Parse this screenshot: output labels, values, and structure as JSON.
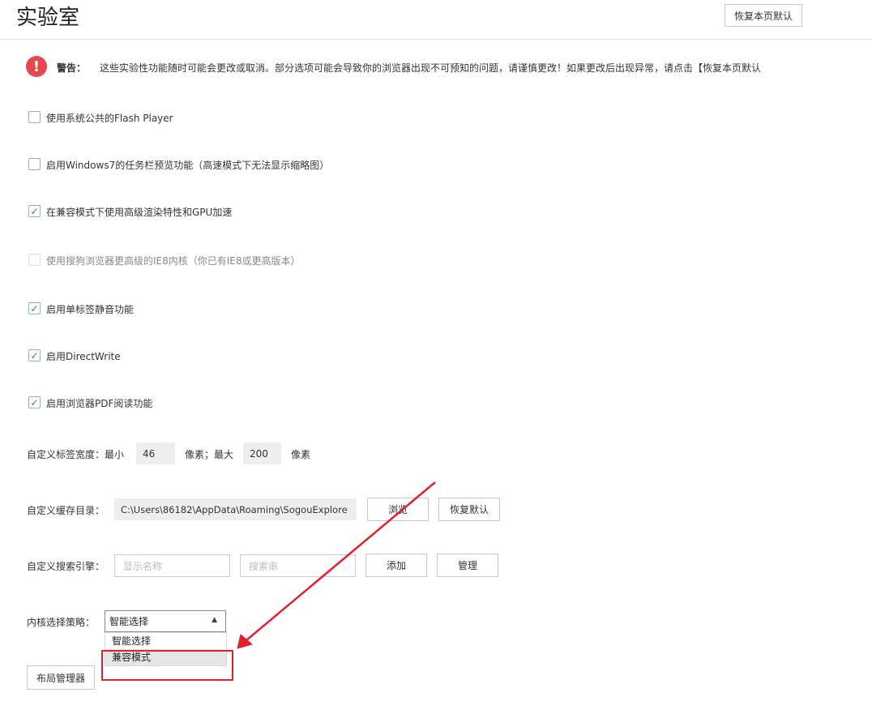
{
  "page": {
    "title": "实验室",
    "restore_page_default": "恢复本页默认"
  },
  "warning": {
    "icon": "!",
    "label": "警告：",
    "text": "这些实验性功能随时可能会更改或取消。部分选项可能会导致你的浏览器出现不可预知的问题，请谨慎更改！如果更改后出现异常，请点击【恢复本页默认"
  },
  "options": [
    {
      "label": "使用系统公共的Flash Player",
      "checked": false,
      "disabled": false
    },
    {
      "label": "启用Windows7的任务栏预览功能（高速模式下无法显示缩略图）",
      "checked": false,
      "disabled": false
    },
    {
      "label": "在兼容模式下使用高级渲染特性和GPU加速",
      "checked": true,
      "disabled": false
    },
    {
      "label": "使用搜狗浏览器更高级的IE8内核（你已有IE8或更高版本）",
      "checked": false,
      "disabled": true
    },
    {
      "label": "启用单标签静音功能",
      "checked": true,
      "disabled": false
    },
    {
      "label": "启用DirectWrite",
      "checked": true,
      "disabled": false
    },
    {
      "label": "启用浏览器PDF阅读功能",
      "checked": true,
      "disabled": false
    }
  ],
  "tab_width": {
    "label": "自定义标签宽度：最小",
    "min_value": "46",
    "unit_mid": "像素；最大",
    "max_value": "200",
    "unit_end": "像素"
  },
  "cache_dir": {
    "label": "自定义缓存目录：",
    "path": "C:\\Users\\86182\\AppData\\Roaming\\SogouExplore",
    "browse": "浏览",
    "restore": "恢复默认"
  },
  "search_engine": {
    "label": "自定义搜索引擎：",
    "name_placeholder": "显示名称",
    "query_placeholder": "搜索串",
    "add": "添加",
    "manage": "管理"
  },
  "kernel": {
    "label": "内核选择策略：",
    "selected": "智能选择",
    "options": [
      "智能选择",
      "兼容模式"
    ]
  },
  "layout_manager": "布局管理器",
  "colors": {
    "annotation_red": "#e0212b",
    "warning_red": "#e8474c",
    "check_blue": "#2f73c9"
  }
}
